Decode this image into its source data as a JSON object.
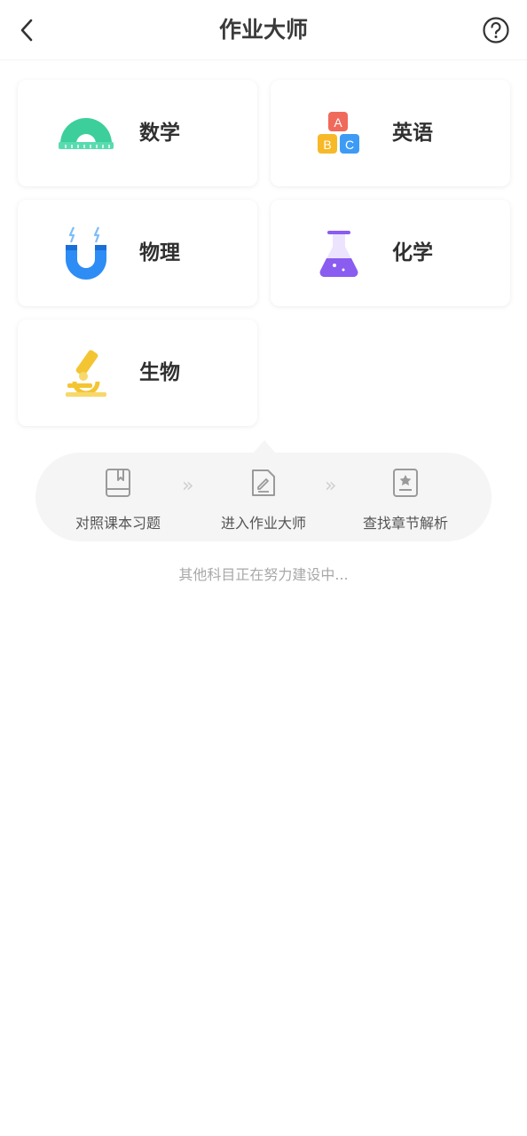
{
  "header": {
    "title": "作业大师"
  },
  "subjects": [
    {
      "label": "数学",
      "icon": "protractor-icon"
    },
    {
      "label": "英语",
      "icon": "abc-blocks-icon"
    },
    {
      "label": "物理",
      "icon": "magnet-icon"
    },
    {
      "label": "化学",
      "icon": "flask-icon"
    },
    {
      "label": "生物",
      "icon": "microscope-icon"
    }
  ],
  "flow": {
    "steps": [
      {
        "label": "对照课本习题",
        "icon": "book-icon"
      },
      {
        "label": "进入作业大师",
        "icon": "document-edit-icon"
      },
      {
        "label": "查找章节解析",
        "icon": "star-document-icon"
      }
    ]
  },
  "note": "其他科目正在努力建设中...",
  "colors": {
    "math_green": "#3ccf9b",
    "english_red": "#f06a5c",
    "english_yellow": "#f7b928",
    "english_blue": "#3d9bf5",
    "physics_blue": "#2e8cf5",
    "chemistry_purple": "#8a5cf0",
    "biology_yellow": "#f4c533"
  }
}
